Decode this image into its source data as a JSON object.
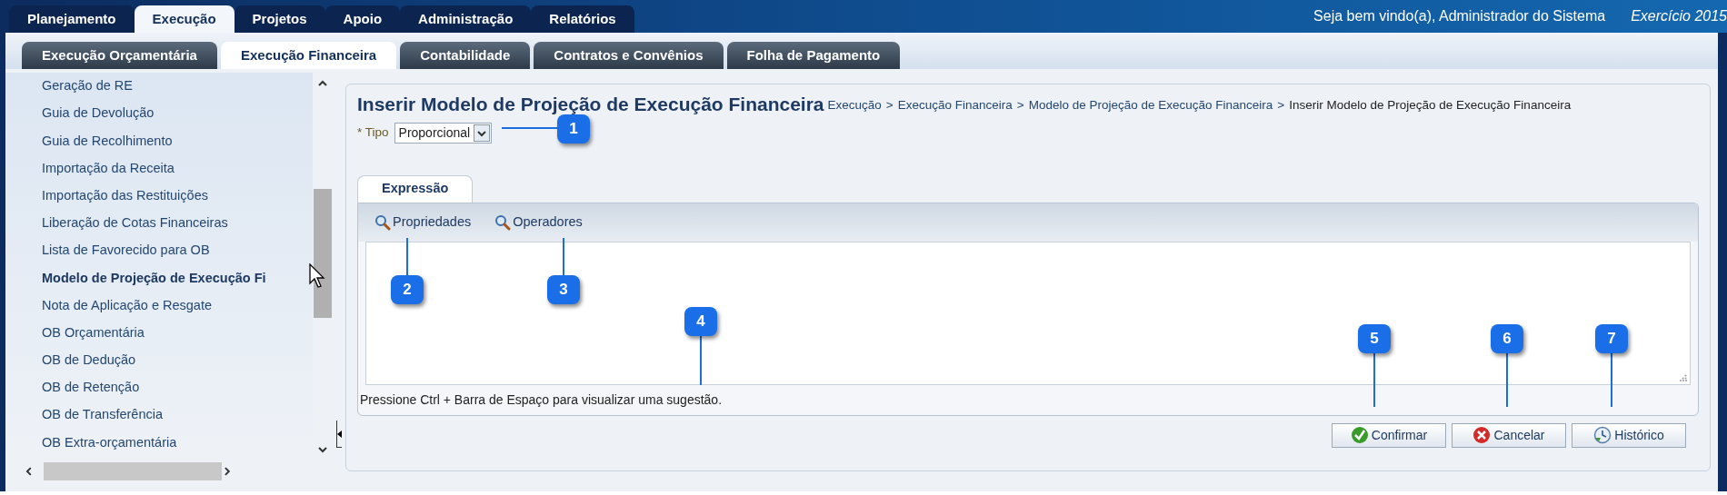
{
  "top_tabs": [
    {
      "label": "Planejamento",
      "selected": false
    },
    {
      "label": "Execução",
      "selected": true
    },
    {
      "label": "Projetos",
      "selected": false
    },
    {
      "label": "Apoio",
      "selected": false
    },
    {
      "label": "Administração",
      "selected": false
    },
    {
      "label": "Relatórios",
      "selected": false
    }
  ],
  "welcome": "Seja bem vindo(a), Administrador do Sistema",
  "exercise": "Exercício 2015",
  "sub_tabs": [
    {
      "label": "Execução Orçamentária",
      "selected": false
    },
    {
      "label": "Execução Financeira",
      "selected": true
    },
    {
      "label": "Contabilidade",
      "selected": false
    },
    {
      "label": "Contratos e Convênios",
      "selected": false
    },
    {
      "label": "Folha de Pagamento",
      "selected": false
    }
  ],
  "sidebar": {
    "items": [
      {
        "label": "Geração de RE",
        "selected": false
      },
      {
        "label": "Guia de Devolução",
        "selected": false
      },
      {
        "label": "Guia de Recolhimento",
        "selected": false
      },
      {
        "label": "Importação da Receita",
        "selected": false
      },
      {
        "label": "Importação das Restituições",
        "selected": false
      },
      {
        "label": "Liberação de Cotas Financeiras",
        "selected": false
      },
      {
        "label": "Lista de Favorecido para OB",
        "selected": false
      },
      {
        "label": "Modelo de Projeção de Execução Fi",
        "selected": true
      },
      {
        "label": "Nota de Aplicação e Resgate",
        "selected": false
      },
      {
        "label": "OB Orçamentária",
        "selected": false
      },
      {
        "label": "OB de Dedução",
        "selected": false
      },
      {
        "label": "OB de Retenção",
        "selected": false
      },
      {
        "label": "OB de Transferência",
        "selected": false
      },
      {
        "label": "OB Extra-orçamentária",
        "selected": false
      }
    ]
  },
  "page": {
    "title": "Inserir Modelo de Projeção de Execução Financeira",
    "breadcrumb_separator": ">",
    "breadcrumb": [
      "Execução",
      "Execução Financeira",
      "Modelo de Projeção de Execução Financeira",
      "Inserir Modelo de Projeção de Execução Financeira"
    ],
    "tipo": {
      "required_mark": "*",
      "label": "Tipo",
      "value": "Proporcional"
    },
    "expression_tab": {
      "label": "Expressão",
      "selected": true
    },
    "toolbar": [
      "Propriedades",
      "Operadores"
    ],
    "hint": "Pressione Ctrl + Barra de Espaço para visualizar uma sugestão.",
    "buttons": [
      {
        "label": "Confirmar",
        "kind": "confirm"
      },
      {
        "label": "Cancelar",
        "kind": "cancel"
      },
      {
        "label": "Histórico",
        "kind": "history"
      }
    ]
  },
  "callouts": [
    "1",
    "2",
    "3",
    "4",
    "5",
    "6",
    "7"
  ]
}
